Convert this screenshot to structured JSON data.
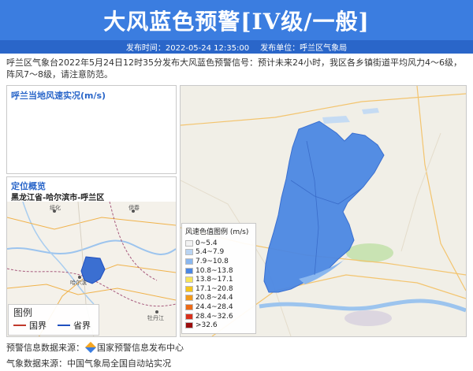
{
  "header": {
    "title": "大风蓝色预警[IV级/一般]"
  },
  "meta": {
    "publish_time_label": "发布时间：",
    "publish_time": "2022-05-24 12:35:00",
    "publisher_label": "发布单位：",
    "publisher": "呼兰区气象局"
  },
  "description": "呼兰区气象台2022年5月24日12时35分发布大风蓝色预警信号：预计未来24小时，我区各乡镇街道平均风力4～6级，阵风7～8级，请注意防范。",
  "panels": {
    "wind_title": "呼兰当地风速实况(m/s)",
    "locate_title": "定位概览",
    "locate_path": "黑龙江省-哈尔滨市-呼兰区"
  },
  "mini_map_labels": {
    "suihua": "绥化",
    "yichun": "伊春",
    "harbin": "哈尔滨",
    "mudanjiang": "牡丹江"
  },
  "boundary_legend": {
    "title": "图例",
    "national": "国界",
    "provincial": "省界",
    "national_color": "#c0392b",
    "provincial_color": "#1f4fbf"
  },
  "wind_legend": {
    "title": "风速色值图例 (m/s)",
    "items": [
      {
        "label": "0~5.4",
        "color": "#f2f2f2"
      },
      {
        "label": "5.4~7.9",
        "color": "#b9d4f2"
      },
      {
        "label": "7.9~10.8",
        "color": "#8ab7ef"
      },
      {
        "label": "10.8~13.8",
        "color": "#4b87e3"
      },
      {
        "label": "13.8~17.1",
        "color": "#f7e45a"
      },
      {
        "label": "17.1~20.8",
        "color": "#f5c51b"
      },
      {
        "label": "20.8~24.4",
        "color": "#f29a1a"
      },
      {
        "label": "24.4~28.4",
        "color": "#ec6a16"
      },
      {
        "label": "28.4~32.6",
        "color": "#d8301c"
      },
      {
        "label": ">32.6",
        "color": "#9b0d0d"
      }
    ]
  },
  "footer": {
    "source_label": "预警信息数据来源：",
    "source": "国家预警信息发布中心",
    "weather_label": "气象数据来源：",
    "weather": "中国气象局全国自动站实况"
  },
  "colors": {
    "header_bg": "#3b7de0",
    "subbar_bg": "#2a66c9",
    "district_fill": "#4b87e3"
  }
}
